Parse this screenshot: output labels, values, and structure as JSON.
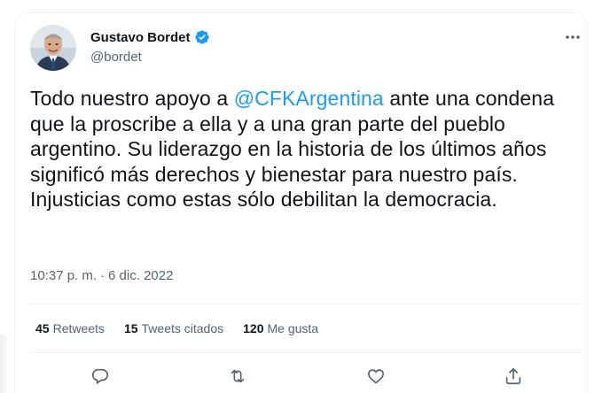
{
  "author": {
    "display_name": "Gustavo Bordet",
    "handle": "@bordet",
    "verified": true,
    "avatar_icon": "user-avatar-photo"
  },
  "tweet": {
    "text_before_mention": "Todo nuestro apoyo a ",
    "mention": "@CFKArgentina",
    "text_after_mention": " ante una condena que la proscribe a ella y a una gran parte del pueblo argentino. Su liderazgo en la historia de los últimos años significó más derechos y bienestar para nuestro país. Injusticias como estas sólo debilitan la democracia.",
    "time": "10:37 p. m.",
    "separator": "·",
    "date": "6 dic. 2022"
  },
  "stats": {
    "retweets_count": "45",
    "retweets_label": "Retweets",
    "quotes_count": "15",
    "quotes_label": "Tweets citados",
    "likes_count": "120",
    "likes_label": "Me gusta"
  },
  "icons": {
    "more": "more-dots-icon",
    "reply": "reply-icon",
    "retweet": "retweet-icon",
    "like": "heart-icon",
    "share": "share-icon",
    "verified": "verified-badge-icon"
  },
  "colors": {
    "accent": "#1d9bf0",
    "text_primary": "#0f1419",
    "text_secondary": "#536471",
    "border": "#eff3f4"
  }
}
